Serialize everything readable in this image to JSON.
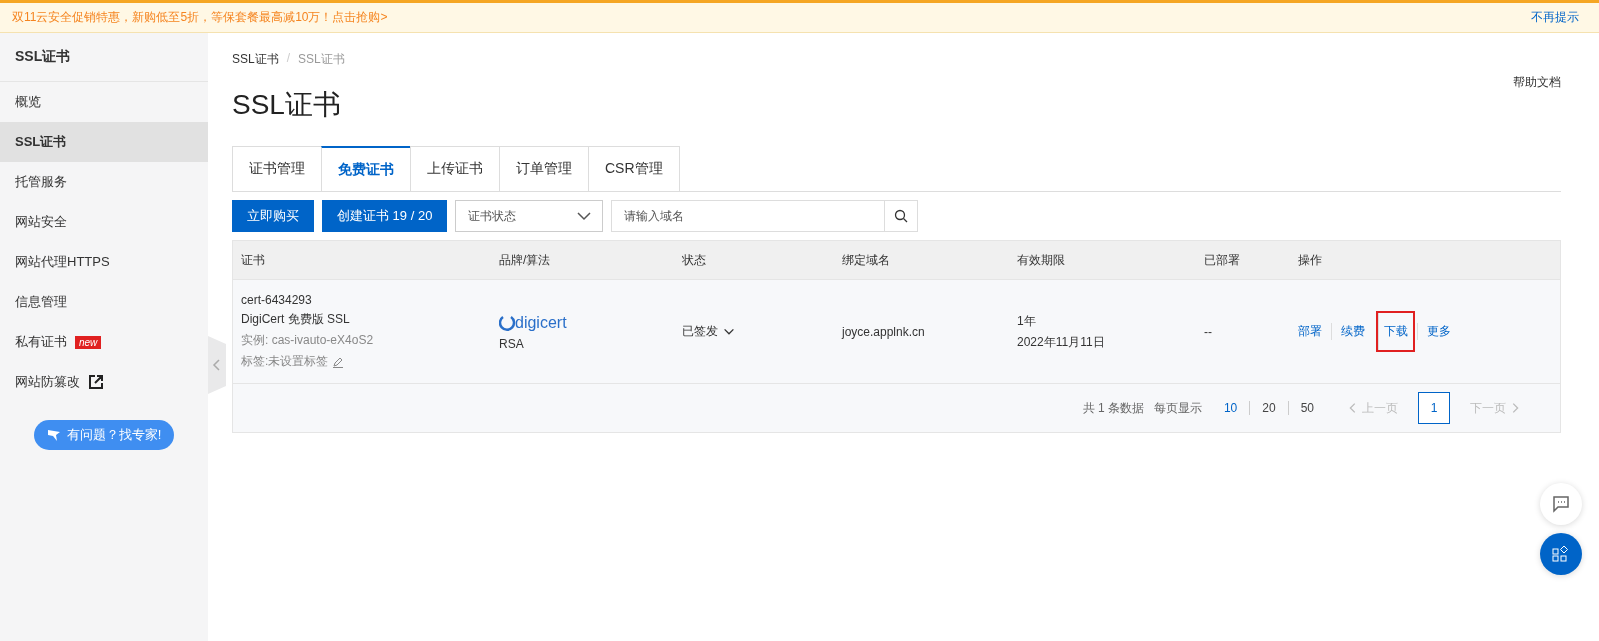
{
  "banner": {
    "text": "双11云安全促销特惠，新购低至5折，等保套餐最高减10万！点击抢购>",
    "dismiss": "不再提示"
  },
  "sidebar": {
    "title": "SSL证书",
    "items": [
      {
        "label": "概览",
        "selected": false
      },
      {
        "label": "SSL证书",
        "selected": true
      },
      {
        "label": "托管服务",
        "selected": false
      },
      {
        "label": "网站安全",
        "selected": false
      },
      {
        "label": "网站代理HTTPS",
        "selected": false
      },
      {
        "label": "信息管理",
        "selected": false
      },
      {
        "label": "私有证书",
        "selected": false,
        "badge": "new"
      },
      {
        "label": "网站防篡改",
        "selected": false,
        "external": true
      }
    ],
    "help_button": "有问题？找专家!"
  },
  "breadcrumb": [
    "SSL证书",
    "SSL证书"
  ],
  "breadcrumb_separator": "/",
  "page_title": "SSL证书",
  "help_link": "帮助文档",
  "tabs": [
    {
      "label": "证书管理",
      "selected": false
    },
    {
      "label": "免费证书",
      "selected": true
    },
    {
      "label": "上传证书",
      "selected": false
    },
    {
      "label": "订单管理",
      "selected": false
    },
    {
      "label": "CSR管理",
      "selected": false
    }
  ],
  "toolbar": {
    "buttons": [
      "立即购买",
      "创建证书 19 / 20"
    ],
    "status_select": {
      "placeholder": "证书状态"
    },
    "search": {
      "placeholder": "请输入域名"
    }
  },
  "table": {
    "columns": [
      "证书",
      "品牌/算法",
      "状态",
      "绑定域名",
      "有效期限",
      "已部署",
      "操作"
    ],
    "rows": [
      {
        "name": "cert-6434293",
        "product": "DigiCert 免费版 SSL",
        "instance": "实例: cas-ivauto-eX4oS2",
        "tag": "标签:未设置标签",
        "brand": "digicert",
        "algorithm": "RSA",
        "status": "已签发",
        "domain": "joyce.applnk.cn",
        "validity": "1年",
        "expiry": "2022年11月11日",
        "deployed": "--",
        "actions": [
          {
            "label": "部署",
            "highlighted": false
          },
          {
            "label": "续费",
            "highlighted": false
          },
          {
            "label": "下载",
            "highlighted": true
          },
          {
            "label": "更多",
            "highlighted": false
          }
        ]
      }
    ]
  },
  "pagination": {
    "total": "共 1 条数据",
    "page_size_label": "每页显示",
    "page_sizes": [
      {
        "label": "10",
        "selected": true
      },
      {
        "label": "20",
        "selected": false
      },
      {
        "label": "50",
        "selected": false
      }
    ],
    "prev": "上一页",
    "pages": [
      {
        "label": "1",
        "selected": true
      }
    ],
    "next": "下一页"
  }
}
